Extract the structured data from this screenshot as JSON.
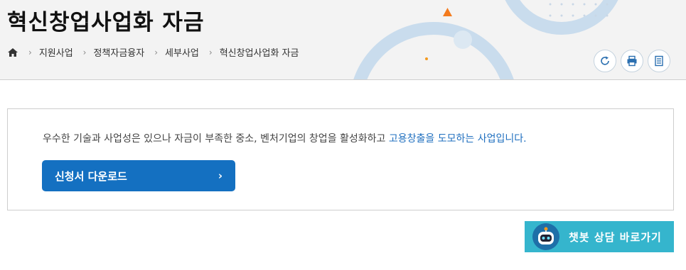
{
  "page": {
    "title": "혁신창업사업화 자금",
    "breadcrumb": [
      "지원사업",
      "정책자금융자",
      "세부사업",
      "혁신창업사업화 자금"
    ],
    "tools": [
      "refresh-icon",
      "print-icon",
      "document-icon"
    ]
  },
  "content": {
    "description_plain": "우수한 기술과 사업성은 있으나 자금이 부족한 중소, 벤처기업의 창업을 활성화하고 ",
    "description_highlight": "고용창출을 도모하는 사업입니다.",
    "download_label": "신청서 다운로드",
    "download_arrow": "›"
  },
  "chatbot": {
    "label": "챗봇 상담 바로가기"
  },
  "colors": {
    "accent": "#1470c1",
    "highlight": "#1f6fbf",
    "chatbot": "#35b5cd",
    "header_bg": "#f3f3f3"
  }
}
